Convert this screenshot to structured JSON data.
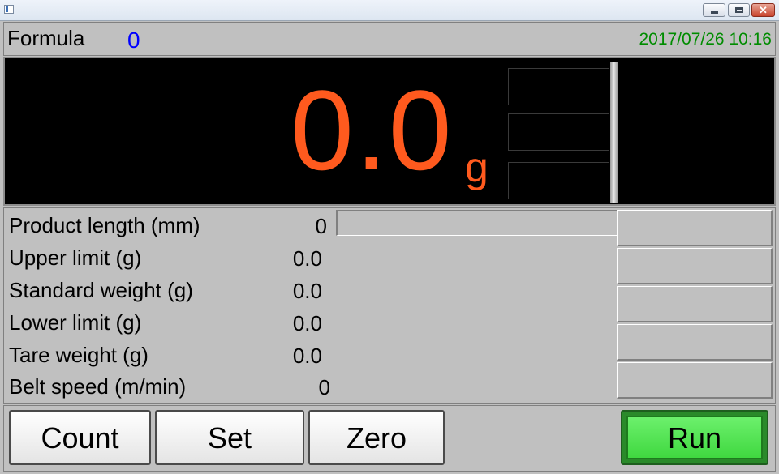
{
  "window": {
    "minimize_glyph": "",
    "maximize_glyph": "",
    "close_glyph": "✕"
  },
  "header": {
    "formula_label": "Formula",
    "formula_value": "0",
    "datetime": "2017/07/26 10:16"
  },
  "display": {
    "weight_value": "0.0",
    "weight_unit": "g",
    "bargraph_level": 0
  },
  "params": [
    {
      "label": "Product length (mm)",
      "value": "0"
    },
    {
      "label": "Upper limit (g)",
      "value": "0.0"
    },
    {
      "label": "Standard weight (g)",
      "value": "0.0"
    },
    {
      "label": "Lower limit (g)",
      "value": "0.0"
    },
    {
      "label": "Tare weight (g)",
      "value": "0.0"
    },
    {
      "label": "Belt speed (m/min)",
      "value": "0"
    }
  ],
  "progress": {
    "level": 0
  },
  "buttons": {
    "count": "Count",
    "set": "Set",
    "zero": "Zero",
    "run": "Run"
  },
  "colors": {
    "weight": "#ff5a1e",
    "formula_value": "#0000ff",
    "datetime": "#008c00",
    "run_button": "#40d840"
  },
  "icons": [
    "app-icon",
    "minimize-icon",
    "maximize-icon",
    "close-icon"
  ]
}
